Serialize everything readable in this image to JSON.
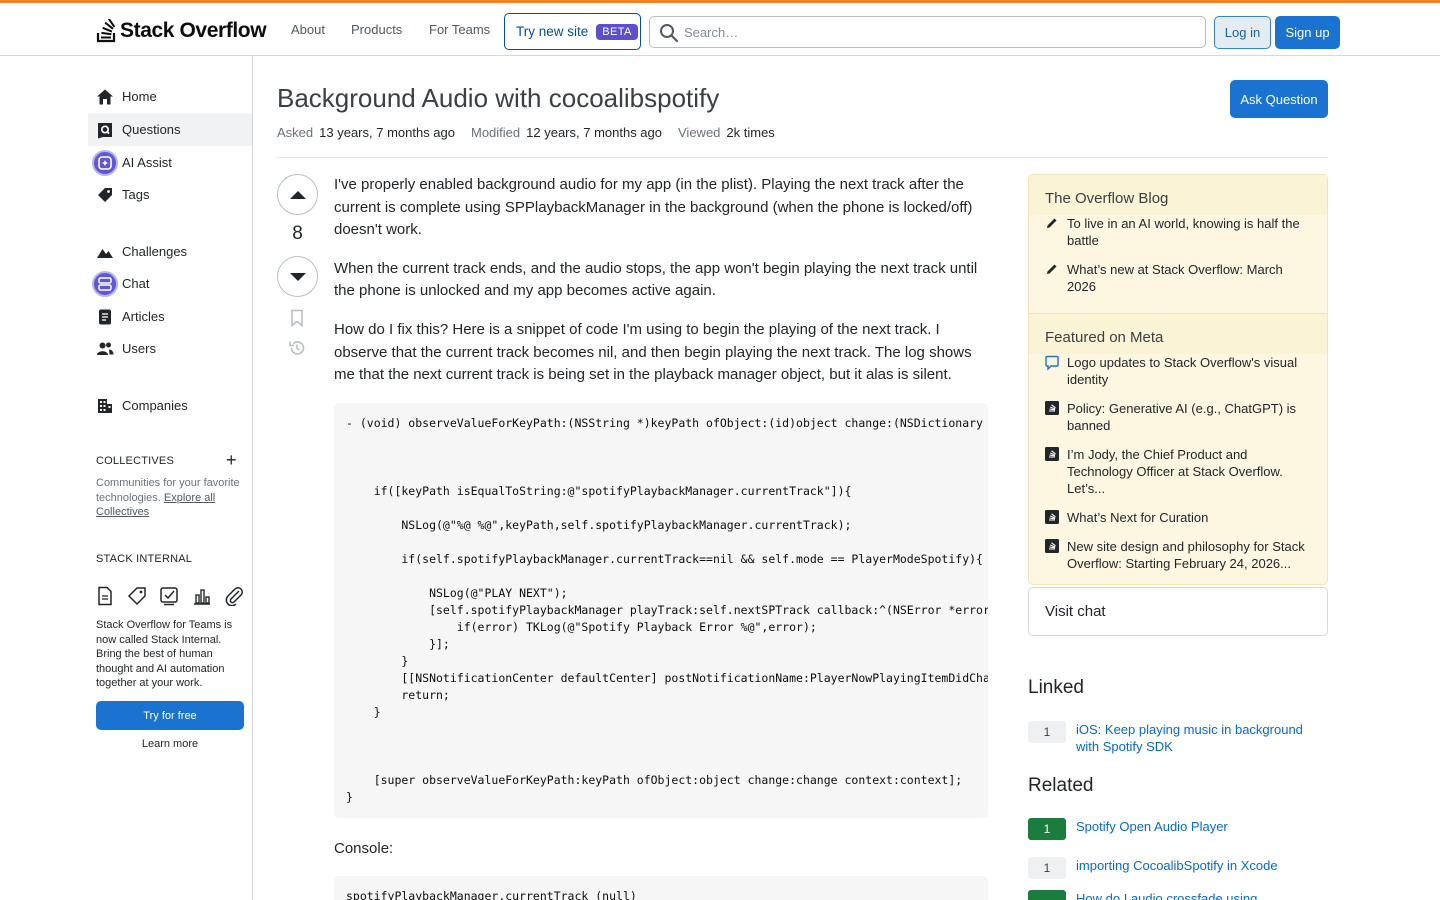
{
  "header": {
    "logo_stack": "Stack",
    "logo_overflow": "Overflow",
    "nav": [
      "About",
      "Products",
      "For Teams"
    ],
    "try_new_site": "Try new site",
    "beta": "BETA",
    "search_placeholder": "Search…",
    "login": "Log in",
    "signup": "Sign up"
  },
  "sidebar": {
    "items": [
      {
        "label": "Home",
        "icon": "home-icon"
      },
      {
        "label": "Questions",
        "icon": "questions-icon",
        "active": true
      },
      {
        "label": "AI Assist",
        "icon": "ai-assist-icon"
      },
      {
        "label": "Tags",
        "icon": "tag-icon"
      },
      {
        "label": "Challenges",
        "icon": "challenges-icon"
      },
      {
        "label": "Chat",
        "icon": "chat-icon"
      },
      {
        "label": "Articles",
        "icon": "articles-icon"
      },
      {
        "label": "Users",
        "icon": "users-icon"
      },
      {
        "label": "Companies",
        "icon": "companies-icon"
      }
    ],
    "collectives_title": "COLLECTIVES",
    "collectives_text": "Communities for your favorite technologies.",
    "collectives_link": "Explore all Collectives",
    "stack_internal_title": "STACK INTERNAL",
    "stack_internal_text": "Stack Overflow for Teams is now called Stack Internal. Bring the best of human thought and AI automation together at your work.",
    "try_free": "Try for free",
    "learn_more": "Learn more"
  },
  "question": {
    "title": "Background Audio with cocoalibspotify",
    "ask_button": "Ask Question",
    "asked_label": "Asked",
    "asked_value": "13 years, 7 months ago",
    "modified_label": "Modified",
    "modified_value": "12 years, 7 months ago",
    "viewed_label": "Viewed",
    "viewed_value": "2k times",
    "votes": "8",
    "paragraphs": [
      "I've properly enabled background audio for my app (in the plist). Playing the next track after the current is complete using SPPlaybackManager in the background (when the phone is locked/off) doesn't work.",
      "When the current track ends, and the audio stops, the app won't begin playing the next track until the phone is unlocked and my app becomes active again.",
      "How do I fix this? Here is a snippet of code I'm using to begin the playing of the next track. I observe that the current track becomes nil, and then begin playing the next track. The log shows me that the next current track is being set in the playback manager object, but it alas is silent."
    ],
    "code": "- (void) observeValueForKeyPath:(NSString *)keyPath ofObject:(id)object change:(NSDictionary *)change context:(void *)context {\n\n\n\n    if([keyPath isEqualToString:@\"spotifyPlaybackManager.currentTrack\"]){\n\n        NSLog(@\"%@ %@\",keyPath,self.spotifyPlaybackManager.currentTrack);\n\n        if(self.spotifyPlaybackManager.currentTrack==nil && self.mode == PlayerModeSpotify){\n\n            NSLog(@\"PLAY NEXT\");\n            [self.spotifyPlaybackManager playTrack:self.nextSPTrack callback:^(NSError *error){\n                if(error) TKLog(@\"Spotify Playback Error %@\",error);\n            }];\n        }\n        [[NSNotificationCenter defaultCenter] postNotificationName:PlayerNowPlayingItemDidChange object:self];\n        return;\n    }\n\n\n\n    [super observeValueForKeyPath:keyPath ofObject:object change:change context:context];\n}",
    "console_label": "Console:",
    "console_code": "spotifyPlaybackManager.currentTrack (null)"
  },
  "right": {
    "blog_title": "The Overflow Blog",
    "blog_items": [
      "To live in an AI world, knowing is half the battle",
      "What’s new at Stack Overflow: March 2026"
    ],
    "meta_title": "Featured on Meta",
    "meta_items": [
      "Logo updates to Stack Overflow's visual identity",
      "Policy: Generative AI (e.g., ChatGPT) is banned",
      "I’m Jody, the Chief Product and Technology Officer at Stack Overflow. Let’s...",
      "What’s Next for Curation",
      "New site design and philosophy for Stack Overflow: Starting February 24, 2026..."
    ],
    "visit_chat": "Visit chat",
    "linked_title": "Linked",
    "linked": [
      {
        "score": "1",
        "title": "iOS: Keep playing music in background with Spotify SDK",
        "accepted": false
      }
    ],
    "related_title": "Related",
    "related": [
      {
        "score": "1",
        "title": "Spotify Open Audio Player",
        "accepted": true
      },
      {
        "score": "1",
        "title": "importing CocoalibSpotify in Xcode",
        "accepted": false
      },
      {
        "score": "",
        "title": "How do I audio crossfade using",
        "accepted": true
      }
    ]
  },
  "colors": {
    "accent": "#f48225",
    "primary": "#1a73d1",
    "link": "#0a6ac8",
    "accepted": "#1b7d3d"
  }
}
